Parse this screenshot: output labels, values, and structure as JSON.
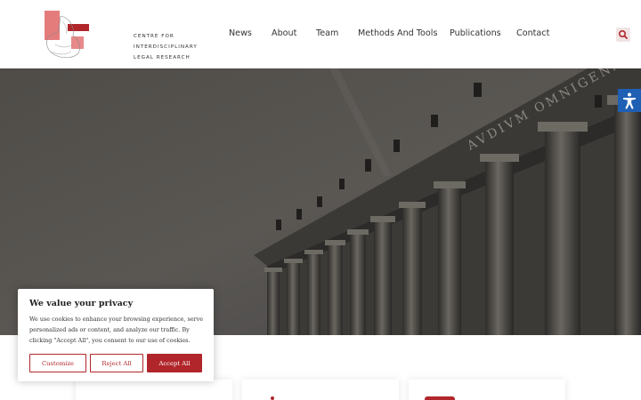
{
  "brand": {
    "lines": [
      "CENTRE FOR",
      "INTERDISCIPLINARY",
      "LEGAL RESEARCH"
    ],
    "accent": "#b1262b",
    "accent_light": "#e57c7c"
  },
  "nav": {
    "items": [
      "News",
      "About",
      "Team",
      "Methods And Tools",
      "Publications",
      "Contact"
    ],
    "search_icon": "search-icon"
  },
  "hero": {
    "frieze_text": "AVDIVM OMNIGENAE"
  },
  "accessibility": {
    "icon": "accessibility-icon",
    "color": "#1f5fb4"
  },
  "cookie": {
    "title": "We value your privacy",
    "text": "We use cookies to enhance your browsing experience, serve personalized ads or content, and analyze our traffic. By clicking \"Accept All\", you consent to our use of cookies.",
    "buttons": {
      "customize": "Customize",
      "reject": "Reject All",
      "accept": "Accept All"
    }
  }
}
